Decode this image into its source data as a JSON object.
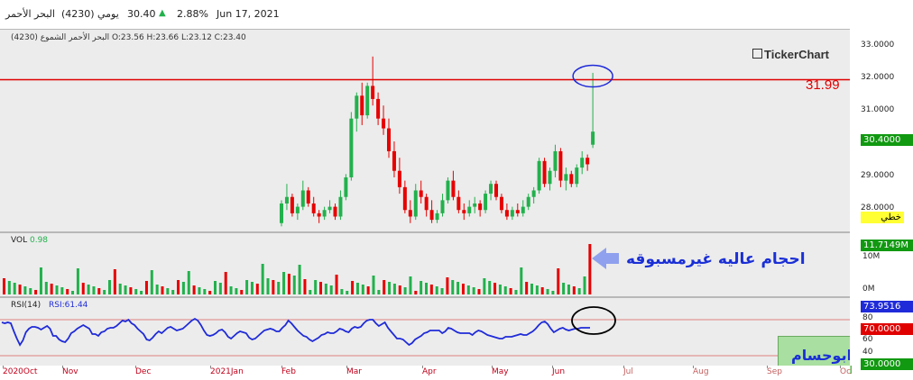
{
  "header": {
    "ticker_ar": "البحر الأحمر",
    "code": "(4230)",
    "period": "يومي",
    "price": "30.40",
    "change": "2.88%",
    "date": "Jun 17, 2021",
    "ohlc_line": "البحر الأحمر الشموع (4230)  O:23.56  H:23.66  L:23.12  C:23.40"
  },
  "brand": "TickerChart",
  "price_panel": {
    "y_ticks": [
      "33.0000",
      "32.0000",
      "31.0000",
      "30.0000",
      "29.0000",
      "28.0000"
    ],
    "last_price_tag": "30.4000",
    "scale_tag": "خطي",
    "resistance_label": "31.99"
  },
  "volume_panel": {
    "label": "VOL",
    "value": "0.98",
    "last_tag": "11.7149M",
    "tick_10m": "10M",
    "tick_0": "0M",
    "annotation": "احجام عاليه غيرمسبوقه"
  },
  "rsi_panel": {
    "label": "RSI(14)",
    "value": "RSI:61.44",
    "value_tag": "73.9516",
    "level_70": "70.0000",
    "level_30": "30.0000",
    "tick_80": "80",
    "tick_60": "60",
    "tick_40": "40"
  },
  "x_axis_labels": [
    "2020Oct",
    "Nov",
    "Dec",
    "2021Jan",
    "Feb",
    "Mar",
    "Apr",
    "May",
    "Jun",
    "Jul",
    "Aug",
    "Sep",
    "Oc"
  ],
  "watermark": "ابوحسام",
  "colors": {
    "up": "#22b14c",
    "down": "#e60000",
    "resistance": "#e00000",
    "rsi_line": "#1f2bd8",
    "price_tag": "#119911",
    "rsi_tag": "#1f2bd8",
    "level_tag": "#e00000",
    "annotation": "#1a2fd6",
    "arrow": "#8fa0ee"
  },
  "chart_data": {
    "type": "candlestick",
    "title": "البحر الأحمر (4230) يومي",
    "resistance": 31.99,
    "ylim": [
      27.4,
      33.3
    ],
    "x": [
      "2020Oct",
      "Nov",
      "Dec",
      "2021Jan",
      "Feb",
      "Mar",
      "Apr",
      "May",
      "Jun",
      "Jul",
      "Aug",
      "Sep"
    ],
    "candles": [
      [
        27.6,
        28.3,
        27.5,
        28.2
      ],
      [
        28.2,
        28.8,
        28.0,
        28.4
      ],
      [
        28.4,
        28.5,
        27.8,
        27.9
      ],
      [
        27.9,
        28.2,
        27.7,
        28.1
      ],
      [
        28.1,
        28.9,
        28.0,
        28.6
      ],
      [
        28.6,
        28.7,
        28.1,
        28.2
      ],
      [
        28.2,
        28.4,
        27.8,
        27.9
      ],
      [
        27.9,
        28.0,
        27.6,
        27.8
      ],
      [
        27.8,
        28.1,
        27.7,
        28.0
      ],
      [
        28.0,
        28.3,
        27.9,
        28.1
      ],
      [
        28.1,
        28.2,
        27.7,
        27.8
      ],
      [
        27.8,
        28.6,
        27.7,
        28.4
      ],
      [
        28.4,
        29.1,
        28.3,
        29.0
      ],
      [
        29.0,
        31.0,
        28.9,
        30.8
      ],
      [
        30.8,
        31.6,
        30.4,
        31.5
      ],
      [
        31.5,
        31.9,
        30.6,
        30.9
      ],
      [
        30.9,
        31.9,
        30.8,
        31.8
      ],
      [
        31.8,
        32.7,
        31.2,
        31.4
      ],
      [
        31.4,
        31.6,
        30.6,
        30.8
      ],
      [
        30.8,
        31.2,
        30.3,
        30.5
      ],
      [
        30.5,
        30.8,
        29.6,
        29.8
      ],
      [
        29.8,
        30.1,
        29.0,
        29.2
      ],
      [
        29.2,
        29.6,
        28.5,
        28.7
      ],
      [
        28.7,
        28.9,
        27.9,
        28.0
      ],
      [
        28.0,
        28.3,
        27.6,
        27.8
      ],
      [
        27.8,
        28.8,
        27.7,
        28.6
      ],
      [
        28.6,
        28.9,
        28.2,
        28.4
      ],
      [
        28.4,
        28.5,
        27.8,
        28.0
      ],
      [
        28.0,
        28.3,
        27.6,
        27.7
      ],
      [
        27.7,
        28.0,
        27.6,
        27.9
      ],
      [
        27.9,
        28.5,
        27.8,
        28.3
      ],
      [
        28.3,
        29.0,
        28.2,
        28.9
      ],
      [
        28.9,
        29.2,
        28.3,
        28.4
      ],
      [
        28.4,
        28.6,
        27.9,
        28.0
      ],
      [
        28.0,
        28.2,
        27.7,
        27.9
      ],
      [
        27.9,
        28.3,
        27.8,
        28.1
      ],
      [
        28.1,
        28.4,
        27.9,
        28.2
      ],
      [
        28.2,
        28.3,
        27.8,
        28.0
      ],
      [
        28.0,
        28.6,
        27.9,
        28.5
      ],
      [
        28.5,
        28.9,
        28.3,
        28.8
      ],
      [
        28.8,
        28.9,
        28.3,
        28.4
      ],
      [
        28.4,
        28.5,
        27.9,
        28.0
      ],
      [
        28.0,
        28.2,
        27.7,
        27.8
      ],
      [
        27.8,
        28.1,
        27.7,
        28.0
      ],
      [
        28.0,
        28.2,
        27.8,
        27.9
      ],
      [
        27.9,
        28.3,
        27.8,
        28.1
      ],
      [
        28.1,
        28.5,
        28.0,
        28.4
      ],
      [
        28.4,
        28.7,
        28.2,
        28.6
      ],
      [
        28.6,
        29.6,
        28.5,
        29.5
      ],
      [
        29.5,
        29.6,
        28.7,
        28.8
      ],
      [
        28.8,
        29.3,
        28.6,
        29.2
      ],
      [
        29.2,
        30.0,
        29.0,
        29.8
      ],
      [
        29.8,
        29.9,
        28.7,
        28.9
      ],
      [
        28.9,
        29.3,
        28.6,
        29.1
      ],
      [
        29.1,
        29.2,
        28.7,
        28.8
      ],
      [
        28.8,
        29.4,
        28.7,
        29.3
      ],
      [
        29.3,
        29.8,
        29.1,
        29.6
      ],
      [
        29.6,
        29.7,
        29.2,
        29.4
      ],
      [
        30.0,
        32.2,
        29.9,
        30.4
      ]
    ],
    "volume_last": "11.7149M",
    "rsi": {
      "period": 14,
      "last": 61.44,
      "levels": [
        70,
        30
      ],
      "values": [
        67,
        66,
        67,
        66,
        57,
        49,
        42,
        47,
        56,
        60,
        62,
        62,
        61,
        59,
        61,
        63,
        60,
        52,
        52,
        48,
        46,
        45,
        49,
        55,
        57,
        60,
        62,
        64,
        62,
        60,
        54,
        54,
        52,
        56,
        57,
        60,
        61,
        61,
        63,
        66,
        69,
        68,
        70,
        66,
        64,
        60,
        57,
        54,
        48,
        47,
        50,
        54,
        57,
        55,
        58,
        61,
        62,
        60,
        58,
        59,
        60,
        63,
        66,
        69,
        71,
        69,
        64,
        58,
        53,
        52,
        53,
        55,
        58,
        59,
        56,
        51,
        49,
        52,
        55,
        57,
        56,
        55,
        50,
        48,
        49,
        52,
        55,
        58,
        59,
        60,
        59,
        57,
        57,
        61,
        64,
        69,
        66,
        62,
        58,
        55,
        52,
        51,
        48,
        46,
        48,
        50,
        53,
        54,
        56,
        55,
        55,
        57,
        60,
        59,
        57,
        56,
        60,
        62,
        61,
        62,
        66,
        69,
        70,
        70,
        66,
        63,
        65,
        67,
        61,
        57,
        53,
        49,
        49,
        48,
        45,
        42,
        44,
        48,
        50,
        52,
        55,
        56,
        58,
        58,
        58,
        58,
        55,
        57,
        61,
        60,
        58,
        56,
        55,
        55,
        55,
        55,
        53,
        56,
        58,
        57,
        55,
        53,
        52,
        51,
        50,
        49,
        49,
        51,
        51,
        51,
        52,
        53,
        54,
        53,
        53,
        55,
        57,
        60,
        64,
        67,
        68,
        65,
        60,
        56,
        58,
        60,
        61,
        59,
        58,
        59,
        60,
        60,
        61,
        61,
        61,
        61
      ]
    }
  }
}
